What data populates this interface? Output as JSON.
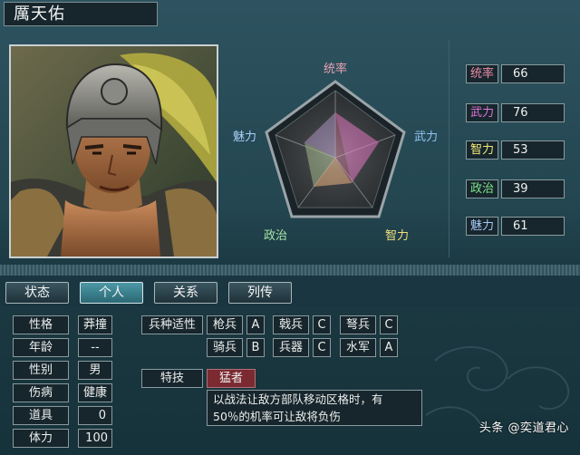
{
  "character": {
    "name": "厲天佑"
  },
  "radar": {
    "labels": [
      {
        "key": "tong",
        "text": "统率",
        "color": "#e8a0b0"
      },
      {
        "key": "wu",
        "text": "武力",
        "color": "#8fc6f0"
      },
      {
        "key": "zhi",
        "text": "智力",
        "color": "#f0e080"
      },
      {
        "key": "zheng",
        "text": "政治",
        "color": "#a8e6a8"
      },
      {
        "key": "mei",
        "text": "魅力",
        "color": "#a8d0f8"
      }
    ]
  },
  "stats": [
    {
      "label": "统率",
      "value": "66",
      "color": "#f08aa8"
    },
    {
      "label": "武力",
      "value": "76",
      "color": "#e074d8"
    },
    {
      "label": "智力",
      "value": "53",
      "color": "#f2e878"
    },
    {
      "label": "政治",
      "value": "39",
      "color": "#7fe28a"
    },
    {
      "label": "魅力",
      "value": "61",
      "color": "#a8c8f8"
    }
  ],
  "tabs": [
    {
      "label": "状态",
      "active": false
    },
    {
      "label": "个人",
      "active": true
    },
    {
      "label": "关系",
      "active": false
    },
    {
      "label": "列传",
      "active": false
    }
  ],
  "personal": [
    {
      "label": "性格",
      "value": "莽撞"
    },
    {
      "label": "年龄",
      "value": "--"
    },
    {
      "label": "性别",
      "value": "男"
    },
    {
      "label": "伤病",
      "value": "健康"
    },
    {
      "label": "道具",
      "value": "0"
    },
    {
      "label": "体力",
      "value": "100"
    }
  ],
  "aptitude": {
    "title": "兵种适性",
    "row1": [
      {
        "unit": "枪兵",
        "grade": "A"
      },
      {
        "unit": "戟兵",
        "grade": "C"
      },
      {
        "unit": "弩兵",
        "grade": "C"
      }
    ],
    "row2": [
      {
        "unit": "骑兵",
        "grade": "B"
      },
      {
        "unit": "兵器",
        "grade": "C"
      },
      {
        "unit": "水军",
        "grade": "A"
      }
    ]
  },
  "skill": {
    "title": "特技",
    "name": "猛者",
    "desc_line1": "以战法让敌方部队移动区格时，有",
    "desc_line2": "50％的机率可让敌将负伤"
  },
  "watermark": "头条 @奕道君心",
  "colors": {
    "accent": "#2b6874",
    "skill_bg": "#7a2a30"
  }
}
